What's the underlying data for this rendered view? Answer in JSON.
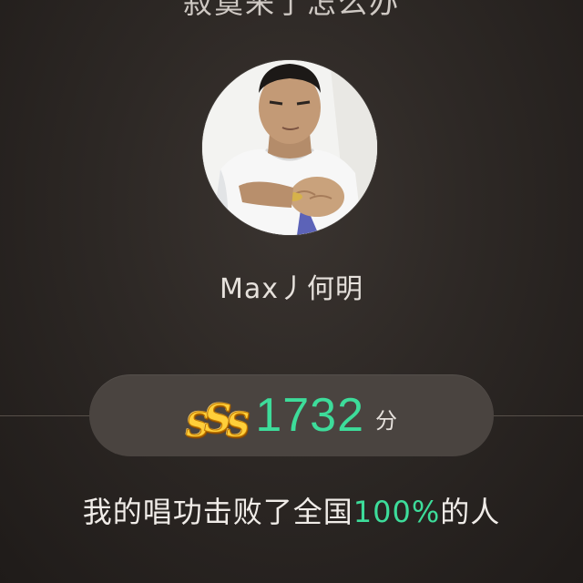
{
  "song": {
    "title": "寂寞来了怎么办"
  },
  "user": {
    "name": "Max丿何明"
  },
  "score": {
    "grade": "SSS",
    "value": "1732",
    "unit": "分"
  },
  "result": {
    "prefix": "我的唱功击败了全国",
    "percent": "100%",
    "suffix": "的人"
  },
  "colors": {
    "accent": "#3ddc9a",
    "grade": "#ffcf3a"
  }
}
